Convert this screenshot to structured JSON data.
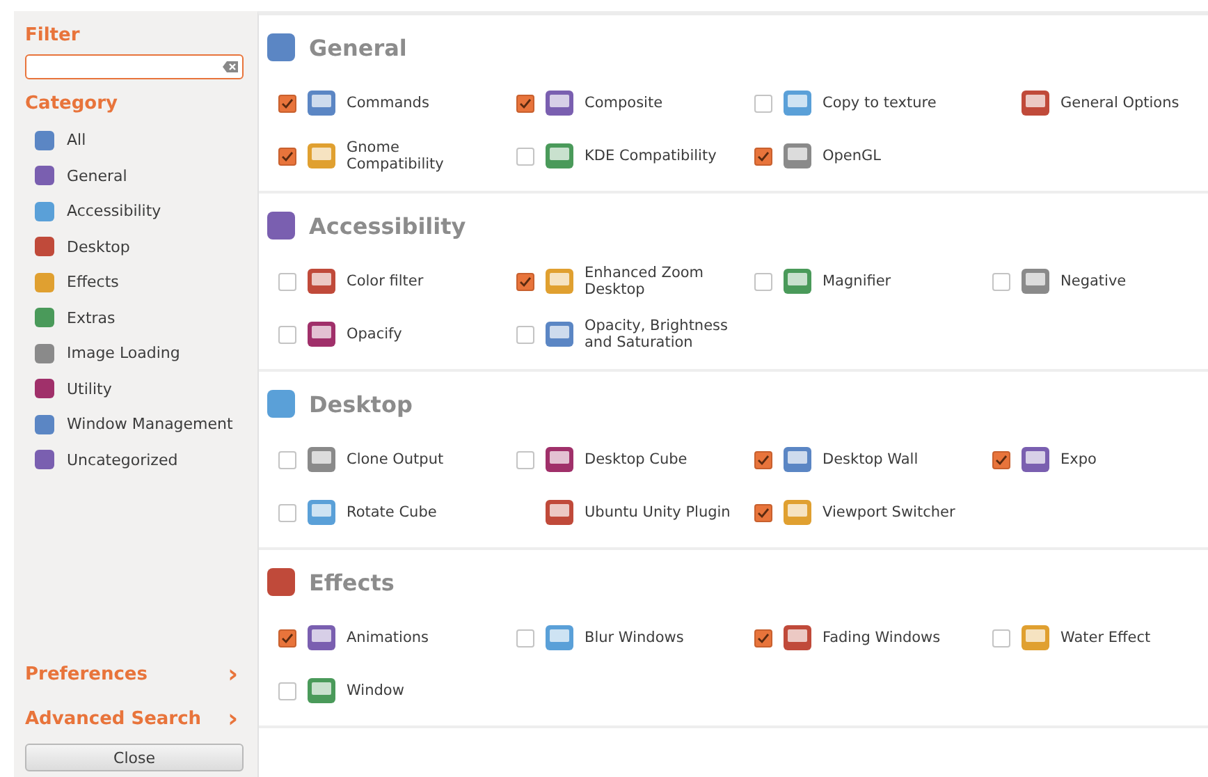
{
  "sidebar": {
    "filter_label": "Filter",
    "category_label": "Category",
    "categories": [
      {
        "label": "All",
        "selected": false
      },
      {
        "label": "General",
        "selected": false
      },
      {
        "label": "Accessibility",
        "selected": false
      },
      {
        "label": "Desktop",
        "selected": false
      },
      {
        "label": "Effects",
        "selected": false
      },
      {
        "label": "Extras",
        "selected": false
      },
      {
        "label": "Image Loading",
        "selected": false
      },
      {
        "label": "Utility",
        "selected": false
      },
      {
        "label": "Window Management",
        "selected": false
      },
      {
        "label": "Uncategorized",
        "selected": false
      }
    ],
    "links": [
      {
        "label": "Preferences",
        "arrow": "›"
      },
      {
        "label": "Advanced Search",
        "arrow": "›"
      }
    ],
    "close_button": "Close"
  },
  "sections": [
    {
      "title": "General",
      "plugins": [
        {
          "name": "Commands",
          "kind": "toggle",
          "checked": true
        },
        {
          "name": "Composite",
          "kind": "toggle",
          "checked": true
        },
        {
          "name": "Copy to texture",
          "kind": "toggle",
          "checked": false
        },
        {
          "name": "General Options",
          "kind": "fixed"
        },
        {
          "name": "Gnome Compatibility",
          "kind": "toggle",
          "checked": true
        },
        {
          "name": "KDE Compatibility",
          "kind": "toggle",
          "checked": false
        },
        {
          "name": "OpenGL",
          "kind": "toggle",
          "checked": true
        }
      ]
    },
    {
      "title": "Accessibility",
      "plugins": [
        {
          "name": "Color filter",
          "kind": "toggle",
          "checked": false
        },
        {
          "name": "Enhanced Zoom Desktop",
          "kind": "toggle",
          "checked": true
        },
        {
          "name": "Magnifier",
          "kind": "toggle",
          "checked": false
        },
        {
          "name": "Negative",
          "kind": "toggle",
          "checked": false
        },
        {
          "name": "Opacify",
          "kind": "toggle",
          "checked": false
        },
        {
          "name": "Opacity, Brightness and Saturation",
          "kind": "toggle",
          "checked": false
        }
      ]
    },
    {
      "title": "Desktop",
      "plugins": [
        {
          "name": "Clone Output",
          "kind": "toggle",
          "checked": false
        },
        {
          "name": "Desktop Cube",
          "kind": "toggle",
          "checked": false
        },
        {
          "name": "Desktop Wall",
          "kind": "toggle",
          "checked": true
        },
        {
          "name": "Expo",
          "kind": "toggle",
          "checked": true
        },
        {
          "name": "Rotate Cube",
          "kind": "toggle",
          "checked": false
        },
        {
          "name": "Ubuntu Unity Plugin",
          "kind": "fixed"
        },
        {
          "name": "Viewport Switcher",
          "kind": "toggle",
          "checked": true
        }
      ]
    },
    {
      "title": "Effects",
      "plugins": [
        {
          "name": "Animations",
          "kind": "toggle",
          "checked": true
        },
        {
          "name": "Blur Windows",
          "kind": "toggle",
          "checked": false
        },
        {
          "name": "Fading Windows",
          "kind": "toggle",
          "checked": true
        },
        {
          "name": "Water Effect",
          "kind": "toggle",
          "checked": false
        },
        {
          "name": "Window",
          "kind": "toggle",
          "checked": false
        }
      ]
    }
  ]
}
